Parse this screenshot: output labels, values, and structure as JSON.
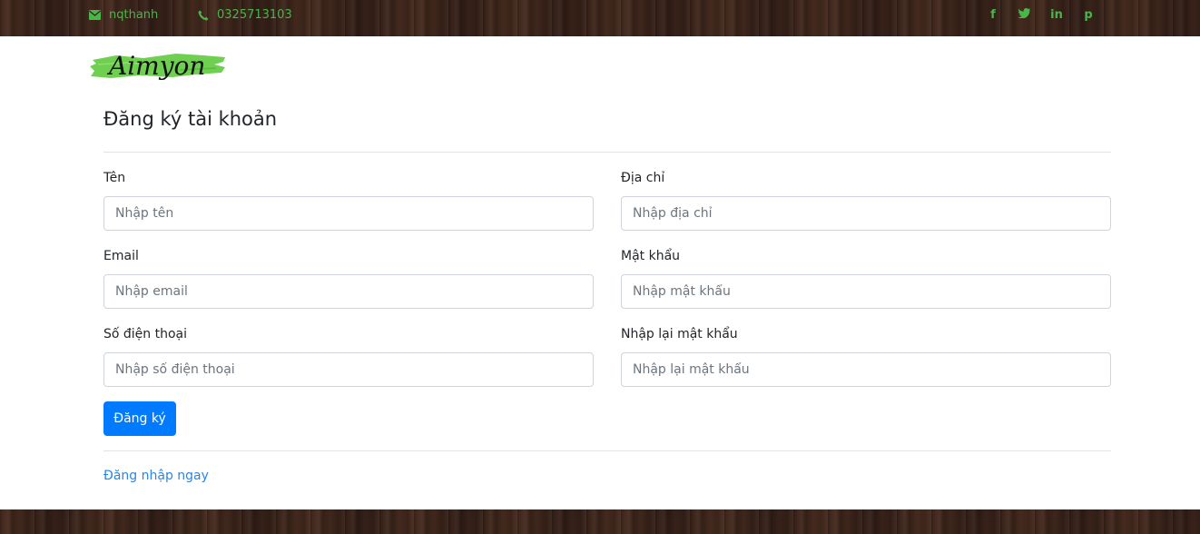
{
  "topbar": {
    "email": "nqthanh",
    "phone": "0325713103",
    "social": [
      {
        "icon": "facebook-icon",
        "glyph": "f"
      },
      {
        "icon": "twitter-icon",
        "glyph": "𝕥"
      },
      {
        "icon": "linkedin-icon",
        "glyph": "in"
      },
      {
        "icon": "pinterest-icon",
        "glyph": "p"
      }
    ],
    "accent": "#49b649"
  },
  "logo": {
    "text": "Aimyon",
    "brush_color": "#6ecf50"
  },
  "form": {
    "title": "Đăng ký tài khoản",
    "fields": {
      "name": {
        "label": "Tên",
        "placeholder": "Nhập tên"
      },
      "address": {
        "label": "Địa chỉ",
        "placeholder": "Nhập địa chỉ"
      },
      "email": {
        "label": "Email",
        "placeholder": "Nhập email"
      },
      "password": {
        "label": "Mật khẩu",
        "placeholder": "Nhập mật khẩu"
      },
      "phone": {
        "label": "Số điện thoại",
        "placeholder": "Nhập số điện thoại"
      },
      "confirm_password": {
        "label": "Nhập lại mật khẩu",
        "placeholder": "Nhập lại mật khẩu"
      }
    },
    "submit_label": "Đăng ký",
    "login_link": "Đăng nhập ngay"
  },
  "colors": {
    "primary": "#007bff",
    "link": "#2a86e0"
  }
}
